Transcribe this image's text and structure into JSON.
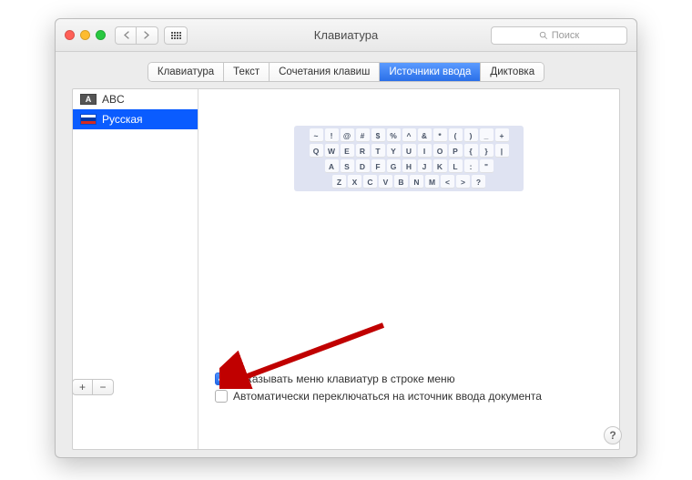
{
  "window_title": "Клавиатура",
  "search_placeholder": "Поиск",
  "tabs": [
    {
      "label": "Клавиатура"
    },
    {
      "label": "Текст"
    },
    {
      "label": "Сочетания клавиш"
    },
    {
      "label": "Источники ввода",
      "active": true
    },
    {
      "label": "Диктовка"
    }
  ],
  "input_sources": [
    {
      "name": "ABC",
      "flag": "abc"
    },
    {
      "name": "Русская",
      "flag": "ru",
      "selected": true
    }
  ],
  "keyboard_rows": [
    [
      "~",
      "!",
      "@",
      "#",
      "$",
      "%",
      "^",
      "&",
      "*",
      "(",
      ")",
      "_",
      "+"
    ],
    [
      "Q",
      "W",
      "E",
      "R",
      "T",
      "Y",
      "U",
      "I",
      "O",
      "P",
      "{",
      "}",
      "|"
    ],
    [
      "A",
      "S",
      "D",
      "F",
      "G",
      "H",
      "J",
      "K",
      "L",
      ":",
      "\""
    ],
    [
      "Z",
      "X",
      "C",
      "V",
      "B",
      "N",
      "M",
      "<",
      ">",
      "?"
    ]
  ],
  "buttons": {
    "add": "+",
    "remove": "−"
  },
  "checkboxes": {
    "show_menu": {
      "checked": true,
      "label": "Показывать меню клавиатур в строке меню"
    },
    "auto_switch": {
      "checked": false,
      "label": "Автоматически переключаться на источник ввода документа"
    }
  },
  "help": "?"
}
